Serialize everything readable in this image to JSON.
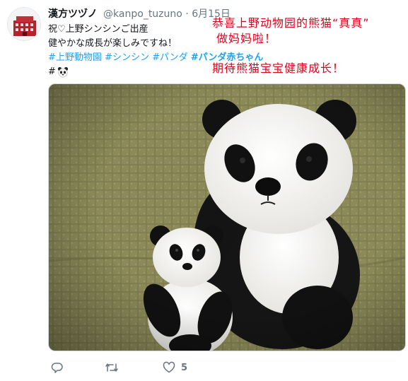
{
  "tweet": {
    "display_name": "漢方ツヅノ",
    "handle": "@kanpo_tuzuno",
    "separator": "·",
    "date": "6月15日",
    "text_line1": "祝♡上野シンシンご出産",
    "text_line2": "健やかな成長が楽しみですね！",
    "hashtags": [
      "#上野動物園",
      "#シンシン",
      "#パンダ",
      "#パンダ赤ちゃん"
    ],
    "hash_prefix": "#",
    "photo_description": "needle felted panda mother with baby panda",
    "actions": {
      "reply_count": "",
      "retweet_count": "",
      "like_count": "5"
    }
  },
  "overlay": {
    "line1": "恭喜上野动物园的熊猫“真真”",
    "line2": "做妈妈啦！",
    "line3": "期待熊猫宝宝健康成长！"
  },
  "colors": {
    "link": "#1da1f2",
    "overlay_text": "#e2001a",
    "muted": "#657786"
  }
}
